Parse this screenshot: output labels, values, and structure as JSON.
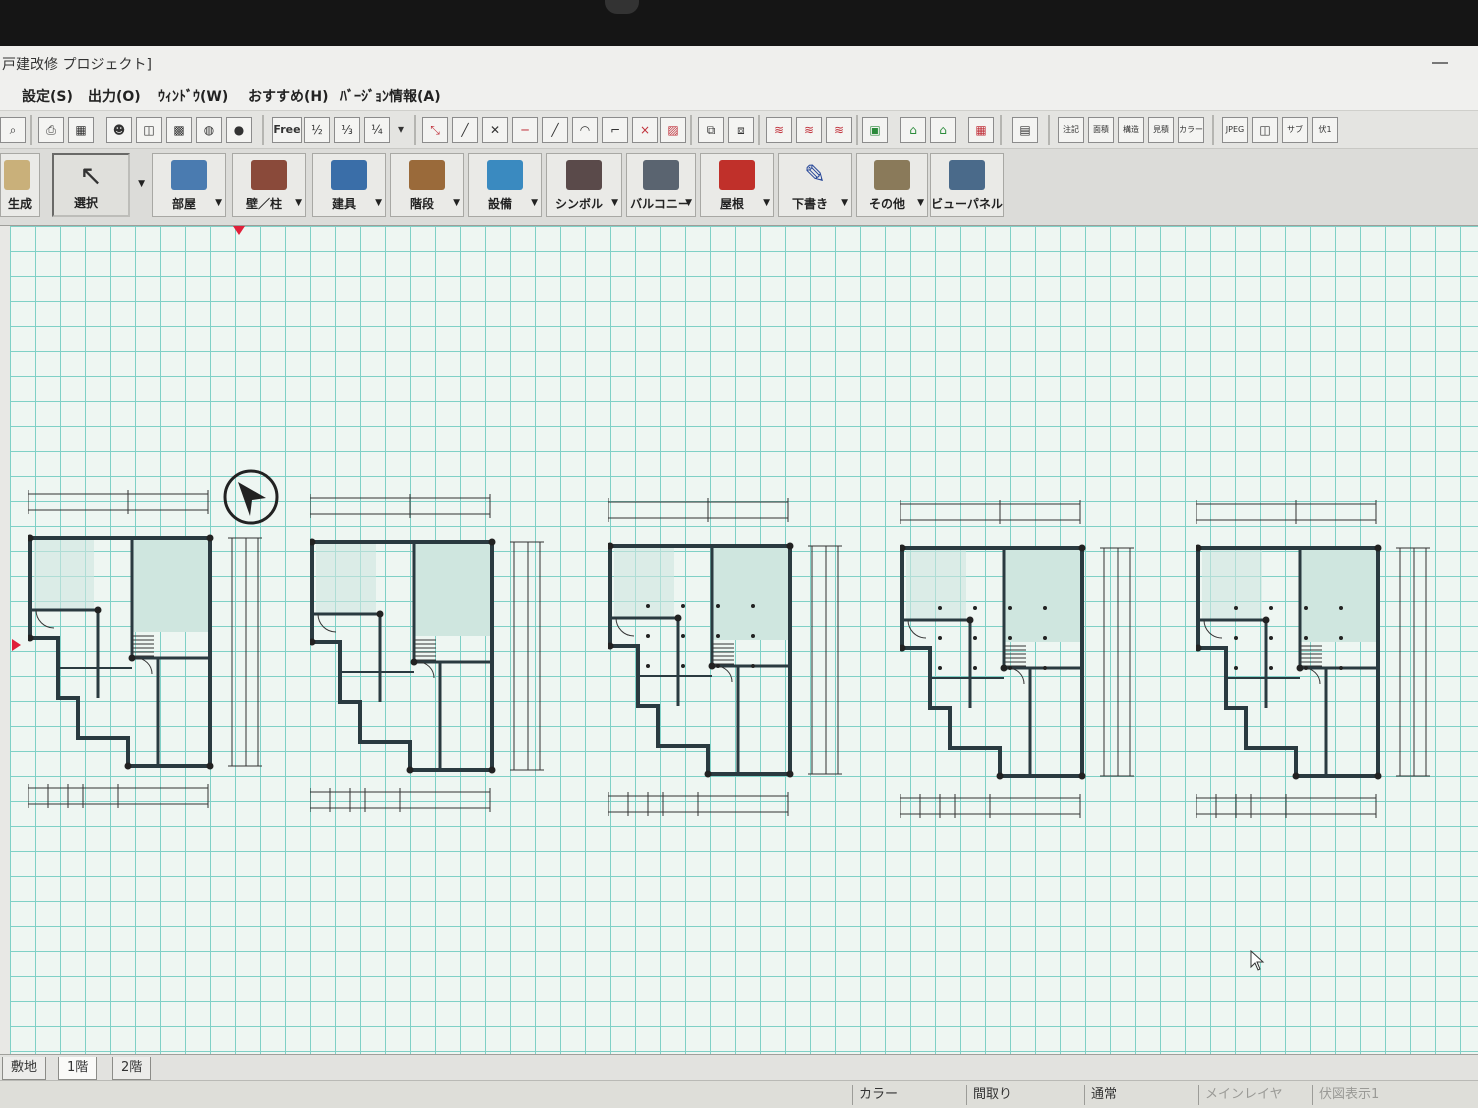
{
  "window": {
    "title": "戸建改修 プロジェクト]"
  },
  "menu": [
    {
      "label": "設定(S)"
    },
    {
      "label": "出力(O)"
    },
    {
      "label": "ｳｨﾝﾄﾞｳ(W)"
    },
    {
      "label": "おすすめ(H)"
    },
    {
      "label": "ﾊﾞｰｼﾞｮﾝ情報(A)"
    }
  ],
  "toolbar_small": {
    "free": "Free",
    "half": "½",
    "third": "⅓",
    "quarter": "¼",
    "b1": "注記",
    "b2": "面積",
    "b3": "構造",
    "b4": "見積",
    "b5": "カラー",
    "b6": "JPEG",
    "b7": "サブ",
    "b8": "伏1"
  },
  "tools": [
    {
      "label": "生成",
      "icon": "hammer-icon"
    },
    {
      "label": "選択",
      "icon": "pointer-icon"
    },
    {
      "label": "部屋",
      "icon": "room-icon"
    },
    {
      "label": "壁／柱",
      "icon": "wall-icon"
    },
    {
      "label": "建具",
      "icon": "door-icon"
    },
    {
      "label": "階段",
      "icon": "stairs-icon"
    },
    {
      "label": "設備",
      "icon": "equipment-icon"
    },
    {
      "label": "シンボル",
      "icon": "symbol-icon"
    },
    {
      "label": "バルコニー",
      "icon": "balcony-icon"
    },
    {
      "label": "屋根",
      "icon": "roof-icon"
    },
    {
      "label": "下書き",
      "icon": "pen-icon"
    },
    {
      "label": "その他",
      "icon": "other-icon"
    },
    {
      "label": "ビューパネル",
      "icon": "view-panel-icon"
    }
  ],
  "tabs": [
    {
      "label": "敷地"
    },
    {
      "label": "1階"
    },
    {
      "label": "2階"
    }
  ],
  "status": [
    {
      "label": "カラー"
    },
    {
      "label": "間取り"
    },
    {
      "label": "通常"
    },
    {
      "label": "メインレイヤ"
    },
    {
      "label": "伏図表示1"
    }
  ],
  "colors": {
    "grid": "#7fd0c6",
    "wall": "#2a3a40",
    "marker": "#e0203a",
    "room_fill": "#cfe6df"
  }
}
